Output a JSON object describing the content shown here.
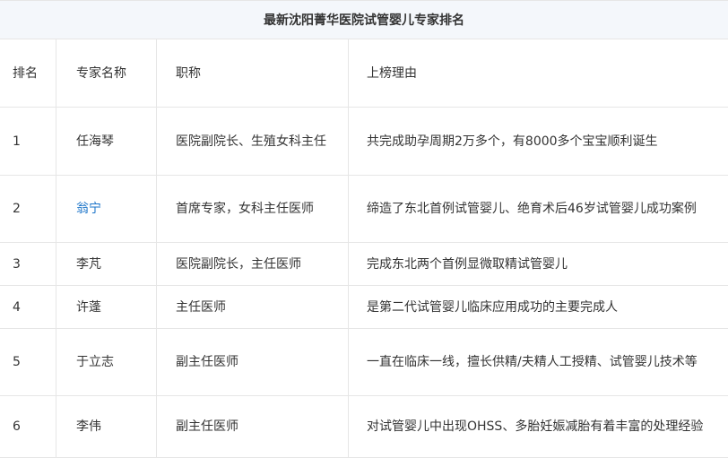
{
  "table": {
    "title": "最新沈阳菁华医院试管婴儿专家排名",
    "headers": {
      "rank": "排名",
      "name": "专家名称",
      "title": "职称",
      "reason": "上榜理由"
    },
    "rows": [
      {
        "rank": "1",
        "name": "任海琴",
        "title": "医院副院长、生殖女科主任",
        "reason": "共完成助孕周期2万多个，有8000多个宝宝顺利诞生"
      },
      {
        "rank": "2",
        "name": "翁宁",
        "title": "首席专家，女科主任医师",
        "reason": "缔造了东北首例试管婴儿、绝育术后46岁试管婴儿成功案例"
      },
      {
        "rank": "3",
        "name": "李芃",
        "title": "医院副院长，主任医师",
        "reason": "完成东北两个首例显微取精试管婴儿"
      },
      {
        "rank": "4",
        "name": "许蓬",
        "title": "主任医师",
        "reason": "是第二代试管婴儿临床应用成功的主要完成人"
      },
      {
        "rank": "5",
        "name": "于立志",
        "title": "副主任医师",
        "reason": "一直在临床一线，擅长供精/夫精人工授精、试管婴儿技术等"
      },
      {
        "rank": "6",
        "name": "李伟",
        "title": "副主任医师",
        "reason": "对试管婴儿中出现OHSS、多胎妊娠减胎有着丰富的处理经验"
      }
    ]
  },
  "colors": {
    "title_bg": "#f4f7fb",
    "border": "#e6e6e6",
    "text": "#333333",
    "link": "#1a73c8"
  }
}
